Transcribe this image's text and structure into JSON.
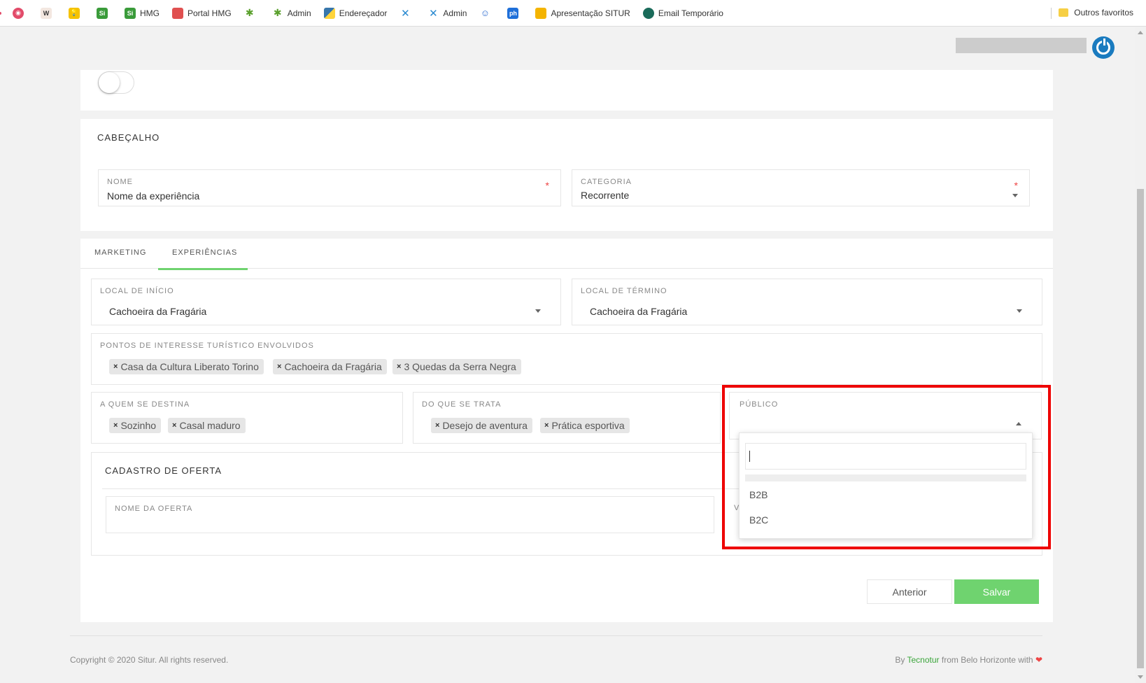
{
  "bookmarks": [
    {
      "label": "",
      "icon": "red-circle-icon",
      "color": "#e24c6a"
    },
    {
      "label": "",
      "icon": "w-icon",
      "color": "#7a3b2e"
    },
    {
      "label": "",
      "icon": "bulb-icon",
      "color": "#f5c200"
    },
    {
      "label": "",
      "icon": "si-icon",
      "color": "#3a9b3a"
    },
    {
      "label": "HMG",
      "icon": "si-icon",
      "color": "#3a9b3a"
    },
    {
      "label": "Portal HMG",
      "icon": "portal-icon",
      "color": "#e05050"
    },
    {
      "label": "",
      "icon": "star-icon",
      "color": "#5aa02c"
    },
    {
      "label": "Admin",
      "icon": "star-icon",
      "color": "#5aa02c"
    },
    {
      "label": "Endereçador",
      "icon": "python-icon",
      "color": "#3776ab"
    },
    {
      "label": "",
      "icon": "x-icon",
      "color": "#2a8ad0"
    },
    {
      "label": "Admin",
      "icon": "x-icon",
      "color": "#2a8ad0"
    },
    {
      "label": "",
      "icon": "bot-icon",
      "color": "#2a6ad0"
    },
    {
      "label": "",
      "icon": "ph-icon",
      "color": "#1e6fd9"
    },
    {
      "label": "Apresentação SITUR",
      "icon": "slides-icon",
      "color": "#f4b400"
    },
    {
      "label": "Email Temporário",
      "icon": "mail-icon",
      "color": "#1a6b5a"
    }
  ],
  "bookmarks_other": "Outros favoritos",
  "form": {
    "cabecalho_title": "CABEÇALHO",
    "nome_label": "NOME",
    "nome_value": "Nome da experiência",
    "categoria_label": "CATEGORIA",
    "categoria_value": "Recorrente",
    "required_mark": "*"
  },
  "tabs": [
    {
      "label": "MARKETING",
      "active": false
    },
    {
      "label": "EXPERIÊNCIAS",
      "active": true
    }
  ],
  "experiencias": {
    "local_inicio_label": "LOCAL DE INÍCIO",
    "local_inicio_value": "Cachoeira da Fragária",
    "local_termino_label": "LOCAL DE TÉRMINO",
    "local_termino_value": "Cachoeira da Fragária",
    "pontos_label": "PONTOS DE INTERESSE TURÍSTICO ENVOLVIDOS",
    "pontos": [
      "Casa da Cultura Liberato Torino",
      "Cachoeira da Fragária",
      "3 Quedas da Serra Negra"
    ],
    "destina_label": "A QUEM SE DESTINA",
    "destina": [
      "Sozinho",
      "Casal maduro"
    ],
    "trata_label": "DO QUE SE TRATA",
    "trata": [
      "Desejo de aventura",
      "Prática esportiva"
    ],
    "publico_label": "PÚBLICO",
    "publico_options": [
      "B2B",
      "B2C"
    ],
    "chip_remove": "×"
  },
  "oferta": {
    "title": "CADASTRO DE OFERTA",
    "nome_label": "NOME DA OFERTA",
    "partial_label": "V"
  },
  "buttons": {
    "anterior": "Anterior",
    "salvar": "Salvar"
  },
  "footer": {
    "copyright": "Copyright © 2020 Situr. All rights reserved.",
    "by_prefix": "By",
    "brand": "Tecnotur",
    "by_suffix": "from Belo Horizonte with",
    "heart": "❤"
  },
  "colors": {
    "accent_green": "#6fd36f",
    "highlight_red": "#e00000",
    "power_blue": "#1a7bbf"
  }
}
